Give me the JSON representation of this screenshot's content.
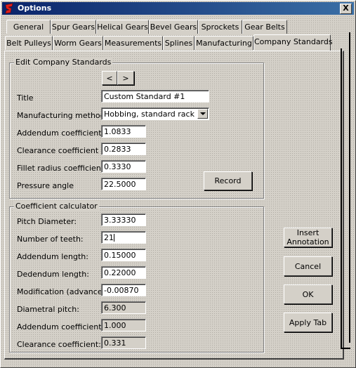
{
  "window": {
    "title": "Options",
    "close_glyph": "X"
  },
  "tabs_row1": [
    {
      "label": "General"
    },
    {
      "label": "Spur Gears"
    },
    {
      "label": "Helical Gears"
    },
    {
      "label": "Bevel Gears"
    },
    {
      "label": "Sprockets"
    },
    {
      "label": "Gear Belts"
    }
  ],
  "tabs_row2": [
    {
      "label": "Belt Pulleys"
    },
    {
      "label": "Worm Gears"
    },
    {
      "label": "Measurements"
    },
    {
      "label": "Splines"
    },
    {
      "label": "Manufacturing"
    },
    {
      "label": "Company Standards"
    }
  ],
  "active_tab": "Company Standards",
  "edit_standards": {
    "legend": "Edit Company Standards",
    "prev_label": "<",
    "next_label": ">",
    "title_label": "Title",
    "title_value": "Custom Standard #1",
    "method_label": "Manufacturing method",
    "method_value": "Hobbing, standard rack",
    "addendum_label": "Addendum coefficient",
    "addendum_value": "1.0833",
    "clearance_label": "Clearance coefficient",
    "clearance_value": "0.2833",
    "fillet_label": "Fillet radius coefficient",
    "fillet_value": "0.3330",
    "pressure_label": "Pressure angle",
    "pressure_value": "22.5000",
    "record_label": "Record"
  },
  "calculator": {
    "legend": "Coefficient calculator",
    "pitch_diameter_label": "Pitch Diameter:",
    "pitch_diameter_value": "3.33330",
    "teeth_label": "Number of teeth:",
    "teeth_value": "21",
    "addendum_length_label": "Addendum length:",
    "addendum_length_value": "0.15000",
    "dedendum_length_label": "Dedendum length:",
    "dedendum_length_value": "0.22000",
    "modification_label": "Modification (advance):",
    "modification_value": "-0.00870",
    "diametral_label": "Diametral pitch:",
    "diametral_value": "6.300",
    "addendum_coef_label": "Addendum coefficient:",
    "addendum_coef_value": "1.000",
    "clearance_coef_label": "Clearance coefficient:",
    "clearance_coef_value": "0.331"
  },
  "side_buttons": {
    "insert_line1": "Insert",
    "insert_line2": "Annotation",
    "cancel": "Cancel",
    "ok": "OK",
    "apply": "Apply Tab"
  },
  "colors": {
    "titlebar": "#0a246a",
    "face": "#d4d0c8",
    "app_icon": "#e0201a"
  },
  "icons": {
    "app": "gear-logo-icon",
    "close": "close-icon",
    "dropdown": "chevron-down-icon"
  }
}
